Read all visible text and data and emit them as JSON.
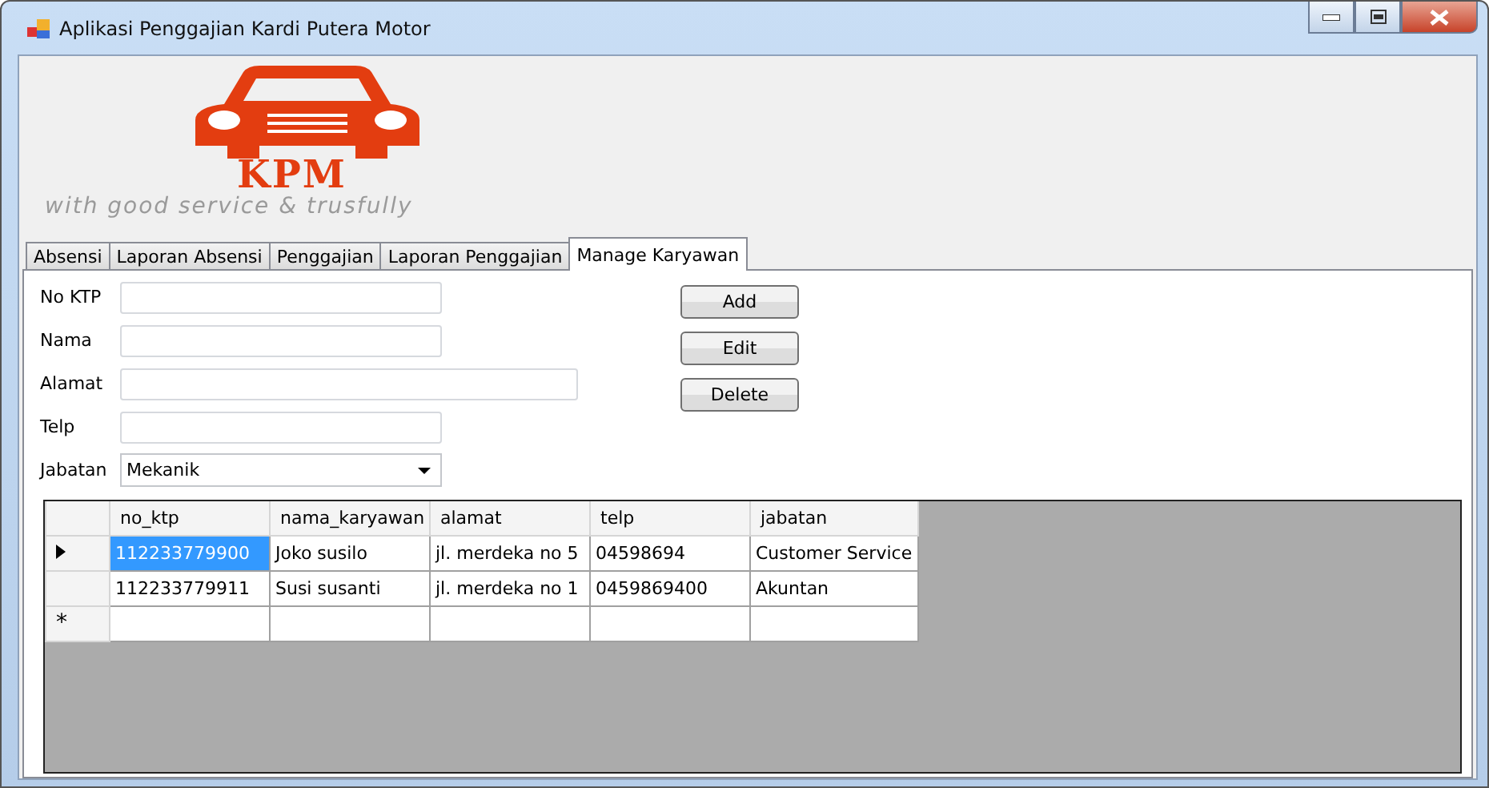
{
  "window": {
    "title": "Aplikasi Penggajian Kardi Putera Motor"
  },
  "logo": {
    "initials": "KPM",
    "tagline": "with good service & trusfully"
  },
  "tabs": [
    {
      "label": "Absensi",
      "selected": false
    },
    {
      "label": "Laporan Absensi",
      "selected": false
    },
    {
      "label": "Penggajian",
      "selected": false
    },
    {
      "label": "Laporan Penggajian",
      "selected": false
    },
    {
      "label": "Manage Karyawan",
      "selected": true
    }
  ],
  "form": {
    "fields": [
      {
        "label": "No KTP",
        "kind": "text"
      },
      {
        "label": "Nama",
        "kind": "text"
      },
      {
        "label": "Alamat",
        "kind": "wide"
      },
      {
        "label": "Telp",
        "kind": "text"
      },
      {
        "label": "Jabatan",
        "kind": "dropdown",
        "value": "Mekanik"
      }
    ],
    "buttons": [
      "Add",
      "Edit",
      "Delete"
    ]
  },
  "table": {
    "columns": [
      "no_ktp",
      "nama_karyawan",
      "alamat",
      "telp",
      "jabatan"
    ],
    "rows": [
      {
        "current": true,
        "cells": [
          {
            "text": "112233779900",
            "selected": true
          },
          {
            "text": "Joko susilo",
            "selected": false
          },
          {
            "text": "jl. merdeka no 5",
            "selected": false
          },
          {
            "text": "04598694",
            "selected": false
          },
          {
            "text": "Customer Service",
            "selected": false
          }
        ]
      },
      {
        "current": false,
        "cells": [
          {
            "text": "112233779911",
            "selected": false
          },
          {
            "text": "Susi susanti",
            "selected": false
          },
          {
            "text": "jl. merdeka no 1",
            "selected": false
          },
          {
            "text": "0459869400",
            "selected": false
          },
          {
            "text": "Akuntan",
            "selected": false
          }
        ]
      }
    ],
    "new_row_marker": "*"
  }
}
